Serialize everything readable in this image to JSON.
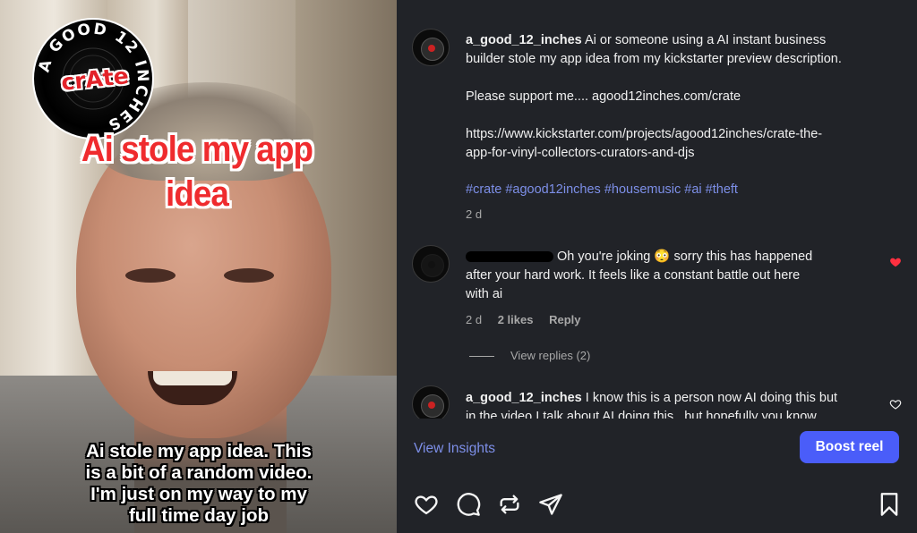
{
  "video": {
    "logo_ring_text": "A GOOD 12 INCHES",
    "logo_center_text": "crAte",
    "headline_lines": [
      "Ai stole my app",
      "idea"
    ],
    "caption_lines": [
      "Ai stole my app idea. This",
      "is a bit of a random video.",
      "I'm just on my way to my",
      "full time day job"
    ]
  },
  "post": {
    "username": "a_good_12_inches",
    "caption_line1": "Ai or someone using a AI instant business",
    "caption_line2": "builder stole my app idea from my kickstarter preview description.",
    "support_text": "Please support me.... agood12inches.com/crate",
    "link_line1": "https://www.kickstarter.com/projects/agood12inches/crate-the-",
    "link_line2": "app-for-vinyl-collectors-curators-and-djs",
    "hashtags": [
      "#crate",
      "#agood12inches",
      "#housemusic",
      "#ai",
      "#theft"
    ],
    "age": "2 d"
  },
  "comments": [
    {
      "username": "",
      "text_line1": "Oh you're joking 😳 sorry this has happened",
      "text_line2": "after your hard work. It feels like a constant battle out here",
      "text_line3": "with ai",
      "age": "2 d",
      "likes": "2 likes",
      "reply_label": "Reply",
      "view_replies": "View replies (2)",
      "liked": true
    },
    {
      "username": "a_good_12_inches",
      "text_line1": "I know this is a person now AI doing this but",
      "text_line2": "in the video I talk about AI doing this.. but hopefully you know",
      "liked": false
    }
  ],
  "footer": {
    "insights_label": "View Insights",
    "boost_label": "Boost reel",
    "icons": [
      "heart-icon",
      "comment-icon",
      "repost-icon",
      "share-icon",
      "bookmark-icon"
    ]
  },
  "colors": {
    "panel_bg": "#212328",
    "link_blue": "#7d8fe8",
    "boost_blue": "#4a5df9",
    "like_red": "#ff3040",
    "headline_red": "#ef2b2e"
  }
}
